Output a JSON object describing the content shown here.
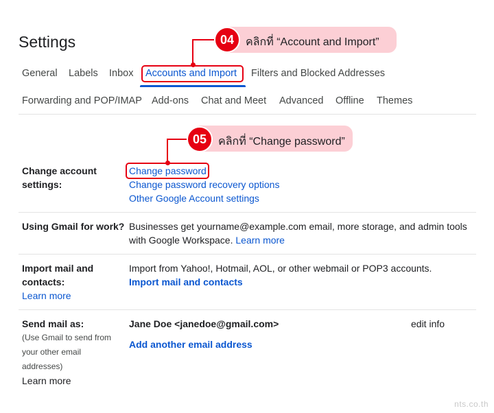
{
  "page": {
    "title": "Settings"
  },
  "tabs": {
    "row1": [
      {
        "label": "General"
      },
      {
        "label": "Labels"
      },
      {
        "label": "Inbox"
      },
      {
        "label": "Accounts and Import",
        "active": true
      },
      {
        "label": "Filters and Blocked Addresses"
      }
    ],
    "row2": [
      {
        "label": "Forwarding and POP/IMAP"
      },
      {
        "label": "Add-ons"
      },
      {
        "label": "Chat and Meet"
      },
      {
        "label": "Advanced"
      },
      {
        "label": "Offline"
      },
      {
        "label": "Themes"
      }
    ]
  },
  "annotations": {
    "step4": {
      "number": "04",
      "text": "คลิกที่ “Account and Import”"
    },
    "step5": {
      "number": "05",
      "text": "คลิกที่ “Change password”"
    },
    "highlight_color": "#e60012",
    "callout_bg": "#fccfd5"
  },
  "sections": {
    "change_account": {
      "label_line1": "Change account",
      "label_line2": "settings:",
      "links": [
        "Change password",
        "Change password recovery options",
        "Other Google Account settings"
      ]
    },
    "gmail_work": {
      "label": "Using Gmail for work?",
      "text_line1": "Businesses get yourname@example.com email, more storage, and admin tools",
      "text_line2": "with Google Workspace.",
      "learn_more": "Learn more"
    },
    "import_mail": {
      "label_line1": "Import mail and",
      "label_line2": "contacts:",
      "learn_more": "Learn more",
      "description": "Import from Yahoo!, Hotmail, AOL, or other webmail or POP3 accounts.",
      "action": "Import mail and contacts"
    },
    "send_mail": {
      "label": "Send mail as:",
      "sub_line1": "(Use Gmail to send from",
      "sub_line2": "your other email",
      "sub_line3": "addresses)",
      "learn_more": "Learn more",
      "identity": "Jane Doe <janedoe@gmail.com>",
      "edit": "edit info",
      "add": "Add another email address"
    }
  },
  "watermark": "nts.co.th",
  "colors": {
    "link": "#0b57d0",
    "text": "#202124",
    "tab_text": "#444746",
    "divider": "#e3e3e3"
  }
}
